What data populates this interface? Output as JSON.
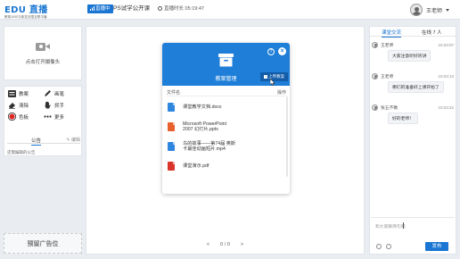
{
  "header": {
    "logo_main": "EDU 直播",
    "logo_sub": "教育1000万新答无限互联平播",
    "live_badge": "直播中",
    "course_title": "PS试学公开课",
    "timer_label": "直播时长",
    "timer_value": "05:19:47",
    "user_name": "王老师"
  },
  "left": {
    "camera_label": "点击打开摄像头",
    "tools": [
      {
        "label": "教案",
        "icon": "lesson-icon"
      },
      {
        "label": "画笔",
        "icon": "pen-icon"
      },
      {
        "label": "清除",
        "icon": "eraser-icon"
      },
      {
        "label": "抓手",
        "icon": "hand-icon"
      },
      {
        "label": "色板",
        "icon": "color-icon"
      },
      {
        "label": "更多",
        "icon": "more-icon"
      }
    ],
    "notice_tab": "公告",
    "notice_edit": "编辑",
    "notice_text": "还需编辑的公告",
    "ad_label": "预留广告位"
  },
  "modal": {
    "title": "教案管理",
    "help": "?",
    "close": "×",
    "upload": "上传教案",
    "col_name": "文件名",
    "col_op": "操作",
    "files": [
      {
        "name": "课堂教学文档.docx",
        "type": "doc",
        "color": "#2f86de"
      },
      {
        "name": "Microsoft PowerPoint 2007 幻灯片.pptx",
        "type": "ppt",
        "color": "#e8612c"
      },
      {
        "name": "鸟的故事——第74届 奥斯卡最佳动画短片.mp4",
        "type": "video",
        "color": "#2f86de"
      },
      {
        "name": "课堂演示.pdf",
        "type": "pdf",
        "color": "#d9342b"
      }
    ]
  },
  "pager": {
    "prev": "<",
    "page": "0 / 0",
    "next": ">"
  },
  "chat": {
    "tab_chat": "课堂交流",
    "tab_online": "在线 7 人",
    "messages": [
      {
        "name": "王老师",
        "time": "10:23:07",
        "text": "大家注意听好听讲"
      },
      {
        "name": "王老师",
        "time": "10:23:13",
        "text": "哪们的准备好上课开始了"
      },
      {
        "name": "张五不散",
        "time": "10:23:22",
        "text": "好的老师！"
      }
    ],
    "input_placeholder": "和大家聊两句吧",
    "send": "发布"
  }
}
